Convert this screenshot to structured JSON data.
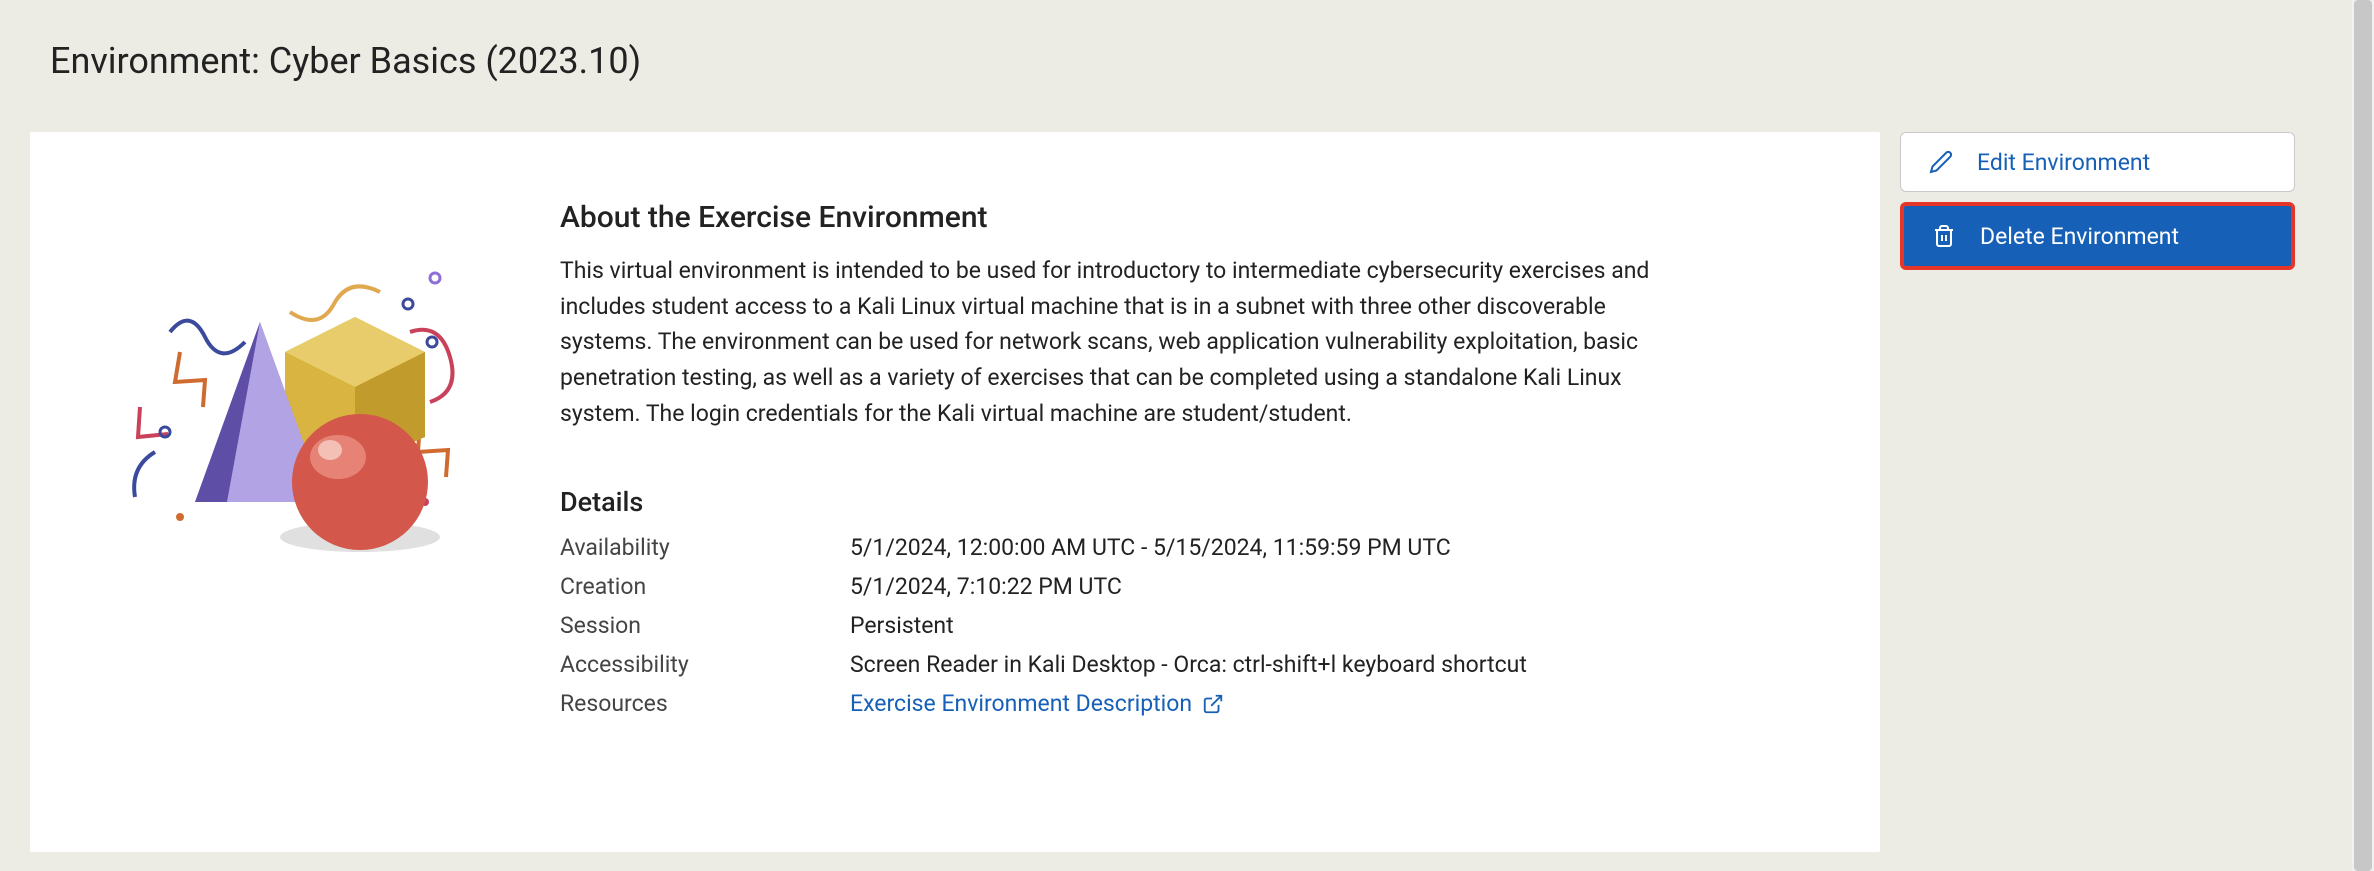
{
  "page": {
    "title": "Environment: Cyber Basics (2023.10)"
  },
  "about": {
    "heading": "About the Exercise Environment",
    "description": "This virtual environment is intended to be used for introductory to intermediate cybersecurity exercises and includes student access to a Kali Linux virtual machine that is in a subnet with three other discoverable systems. The environment can be used for network scans, web application vulnerability exploitation, basic penetration testing, as well as a variety of exercises that can be completed using a standalone Kali Linux system. The login credentials for the Kali virtual machine are student/student."
  },
  "details": {
    "heading": "Details",
    "availability_label": "Availability",
    "availability_value": "5/1/2024, 12:00:00 AM UTC - 5/15/2024, 11:59:59 PM UTC",
    "creation_label": "Creation",
    "creation_value": "5/1/2024, 7:10:22 PM UTC",
    "session_label": "Session",
    "session_value": "Persistent",
    "accessibility_label": "Accessibility",
    "accessibility_value": "Screen Reader in Kali Desktop - Orca: ctrl-shift+l keyboard shortcut",
    "resources_label": "Resources",
    "resources_link_text": "Exercise Environment Description"
  },
  "actions": {
    "edit_label": "Edit Environment",
    "delete_label": "Delete Environment"
  }
}
